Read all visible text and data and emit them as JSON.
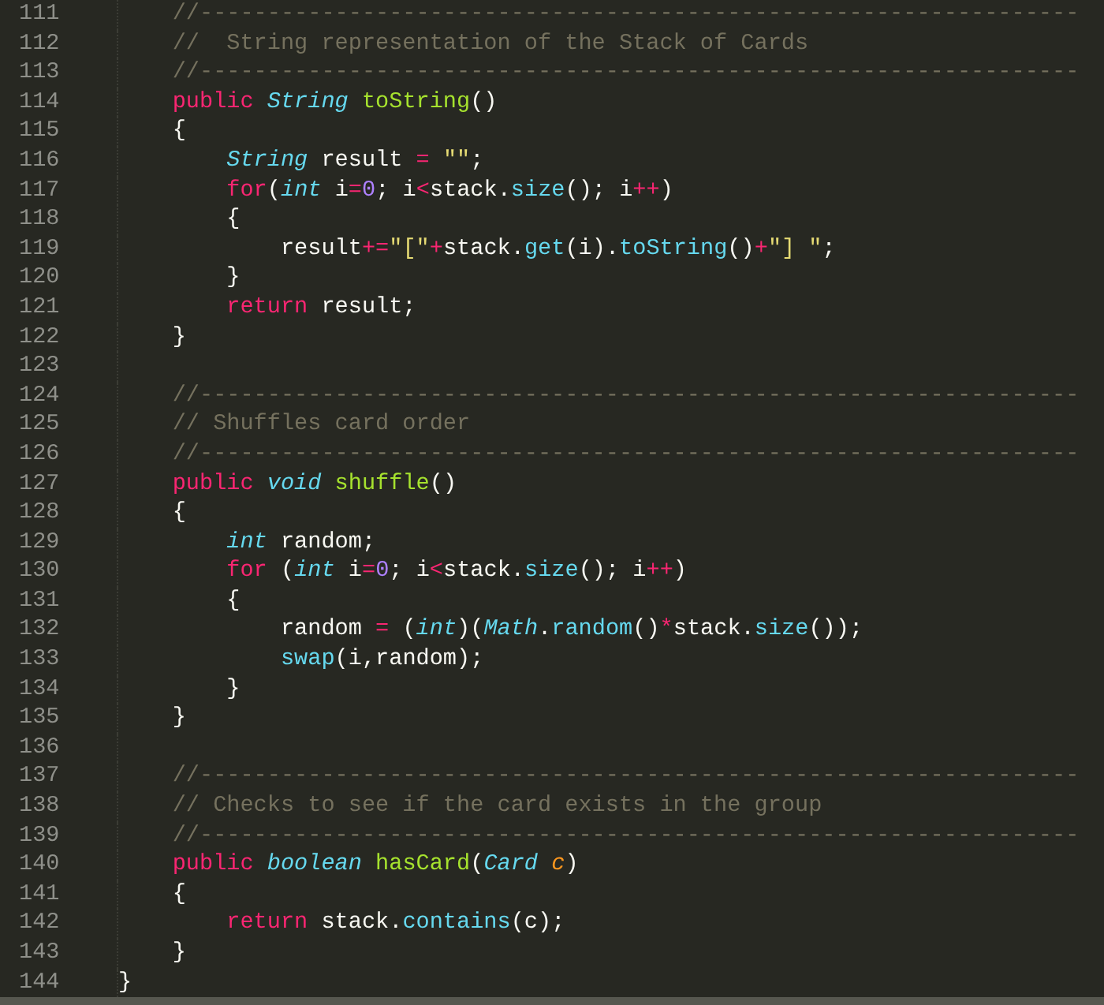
{
  "editor": {
    "lines": [
      {
        "number": "111",
        "tokens": [
          {
            "kind": "comment",
            "text": "    //-----------------------------------------------------------------"
          }
        ]
      },
      {
        "number": "112",
        "tokens": [
          {
            "kind": "comment",
            "text": "    //  String representation of the Stack of Cards"
          }
        ]
      },
      {
        "number": "113",
        "tokens": [
          {
            "kind": "comment",
            "text": "    //-----------------------------------------------------------------"
          }
        ]
      },
      {
        "number": "114",
        "tokens": [
          {
            "kind": "keyword",
            "text": "    public "
          },
          {
            "kind": "type",
            "text": "String "
          },
          {
            "kind": "function",
            "text": "toString"
          },
          {
            "kind": "plain",
            "text": "()"
          }
        ]
      },
      {
        "number": "115",
        "tokens": [
          {
            "kind": "plain",
            "text": "    {"
          }
        ]
      },
      {
        "number": "116",
        "tokens": [
          {
            "kind": "type",
            "text": "        String"
          },
          {
            "kind": "plain",
            "text": " result "
          },
          {
            "kind": "operator",
            "text": "= "
          },
          {
            "kind": "string",
            "text": "\"\""
          },
          {
            "kind": "plain",
            "text": ";"
          }
        ]
      },
      {
        "number": "117",
        "tokens": [
          {
            "kind": "keyword",
            "text": "        for"
          },
          {
            "kind": "plain",
            "text": "("
          },
          {
            "kind": "type",
            "text": "int"
          },
          {
            "kind": "plain",
            "text": " i"
          },
          {
            "kind": "operator",
            "text": "="
          },
          {
            "kind": "number",
            "text": "0"
          },
          {
            "kind": "plain",
            "text": "; i"
          },
          {
            "kind": "operator",
            "text": "<"
          },
          {
            "kind": "plain",
            "text": "stack."
          },
          {
            "kind": "call",
            "text": "size"
          },
          {
            "kind": "plain",
            "text": "(); i"
          },
          {
            "kind": "operator",
            "text": "++"
          },
          {
            "kind": "plain",
            "text": ")"
          }
        ]
      },
      {
        "number": "118",
        "tokens": [
          {
            "kind": "plain",
            "text": "        {"
          }
        ]
      },
      {
        "number": "119",
        "tokens": [
          {
            "kind": "plain",
            "text": "            result"
          },
          {
            "kind": "operator",
            "text": "+="
          },
          {
            "kind": "string",
            "text": "\"[\""
          },
          {
            "kind": "operator",
            "text": "+"
          },
          {
            "kind": "plain",
            "text": "stack."
          },
          {
            "kind": "call",
            "text": "get"
          },
          {
            "kind": "plain",
            "text": "(i)."
          },
          {
            "kind": "call",
            "text": "toString"
          },
          {
            "kind": "plain",
            "text": "()"
          },
          {
            "kind": "operator",
            "text": "+"
          },
          {
            "kind": "string",
            "text": "\"] \""
          },
          {
            "kind": "plain",
            "text": ";"
          }
        ]
      },
      {
        "number": "120",
        "tokens": [
          {
            "kind": "plain",
            "text": "        }"
          }
        ]
      },
      {
        "number": "121",
        "tokens": [
          {
            "kind": "keyword",
            "text": "        return"
          },
          {
            "kind": "plain",
            "text": " result;"
          }
        ]
      },
      {
        "number": "122",
        "tokens": [
          {
            "kind": "plain",
            "text": "    }"
          }
        ]
      },
      {
        "number": "123"
      },
      {
        "number": "124",
        "tokens": [
          {
            "kind": "comment",
            "text": "    //-----------------------------------------------------------------"
          }
        ]
      },
      {
        "number": "125",
        "tokens": [
          {
            "kind": "comment",
            "text": "    // Shuffles card order"
          }
        ]
      },
      {
        "number": "126",
        "tokens": [
          {
            "kind": "comment",
            "text": "    //-----------------------------------------------------------------"
          }
        ]
      },
      {
        "number": "127",
        "tokens": [
          {
            "kind": "keyword",
            "text": "    public "
          },
          {
            "kind": "type",
            "text": "void "
          },
          {
            "kind": "function",
            "text": "shuffle"
          },
          {
            "kind": "plain",
            "text": "()"
          }
        ]
      },
      {
        "number": "128",
        "tokens": [
          {
            "kind": "plain",
            "text": "    {"
          }
        ]
      },
      {
        "number": "129",
        "tokens": [
          {
            "kind": "type",
            "text": "        int"
          },
          {
            "kind": "plain",
            "text": " random;"
          }
        ]
      },
      {
        "number": "130",
        "tokens": [
          {
            "kind": "keyword",
            "text": "        for"
          },
          {
            "kind": "plain",
            "text": " ("
          },
          {
            "kind": "type",
            "text": "int"
          },
          {
            "kind": "plain",
            "text": " i"
          },
          {
            "kind": "operator",
            "text": "="
          },
          {
            "kind": "number",
            "text": "0"
          },
          {
            "kind": "plain",
            "text": "; i"
          },
          {
            "kind": "operator",
            "text": "<"
          },
          {
            "kind": "plain",
            "text": "stack."
          },
          {
            "kind": "call",
            "text": "size"
          },
          {
            "kind": "plain",
            "text": "(); i"
          },
          {
            "kind": "operator",
            "text": "++"
          },
          {
            "kind": "plain",
            "text": ")"
          }
        ]
      },
      {
        "number": "131",
        "tokens": [
          {
            "kind": "plain",
            "text": "        {"
          }
        ]
      },
      {
        "number": "132",
        "tokens": [
          {
            "kind": "plain",
            "text": "            random "
          },
          {
            "kind": "operator",
            "text": "="
          },
          {
            "kind": "plain",
            "text": " ("
          },
          {
            "kind": "type",
            "text": "int"
          },
          {
            "kind": "plain",
            "text": ")("
          },
          {
            "kind": "type",
            "text": "Math"
          },
          {
            "kind": "plain",
            "text": "."
          },
          {
            "kind": "call",
            "text": "random"
          },
          {
            "kind": "plain",
            "text": "()"
          },
          {
            "kind": "operator",
            "text": "*"
          },
          {
            "kind": "plain",
            "text": "stack."
          },
          {
            "kind": "call",
            "text": "size"
          },
          {
            "kind": "plain",
            "text": "());"
          }
        ]
      },
      {
        "number": "133",
        "tokens": [
          {
            "kind": "call",
            "text": "            swap"
          },
          {
            "kind": "plain",
            "text": "(i,random);"
          }
        ]
      },
      {
        "number": "134",
        "tokens": [
          {
            "kind": "plain",
            "text": "        }"
          }
        ]
      },
      {
        "number": "135",
        "tokens": [
          {
            "kind": "plain",
            "text": "    }"
          }
        ]
      },
      {
        "number": "136"
      },
      {
        "number": "137",
        "tokens": [
          {
            "kind": "comment",
            "text": "    //-----------------------------------------------------------------"
          }
        ]
      },
      {
        "number": "138",
        "tokens": [
          {
            "kind": "comment",
            "text": "    // Checks to see if the card exists in the group"
          }
        ]
      },
      {
        "number": "139",
        "tokens": [
          {
            "kind": "comment",
            "text": "    //-----------------------------------------------------------------"
          }
        ]
      },
      {
        "number": "140",
        "tokens": [
          {
            "kind": "keyword",
            "text": "    public "
          },
          {
            "kind": "type",
            "text": "boolean "
          },
          {
            "kind": "function",
            "text": "hasCard"
          },
          {
            "kind": "plain",
            "text": "("
          },
          {
            "kind": "type",
            "text": "Card "
          },
          {
            "kind": "parameter",
            "text": "c"
          },
          {
            "kind": "plain",
            "text": ")"
          }
        ]
      },
      {
        "number": "141",
        "tokens": [
          {
            "kind": "plain",
            "text": "    {"
          }
        ]
      },
      {
        "number": "142",
        "tokens": [
          {
            "kind": "keyword",
            "text": "        return"
          },
          {
            "kind": "plain",
            "text": " stack."
          },
          {
            "kind": "call",
            "text": "contains"
          },
          {
            "kind": "plain",
            "text": "(c);"
          }
        ]
      },
      {
        "number": "143",
        "tokens": [
          {
            "kind": "plain",
            "text": "    }"
          }
        ]
      },
      {
        "number": "144",
        "tokens": [
          {
            "kind": "plain",
            "text": "}"
          }
        ]
      }
    ]
  }
}
